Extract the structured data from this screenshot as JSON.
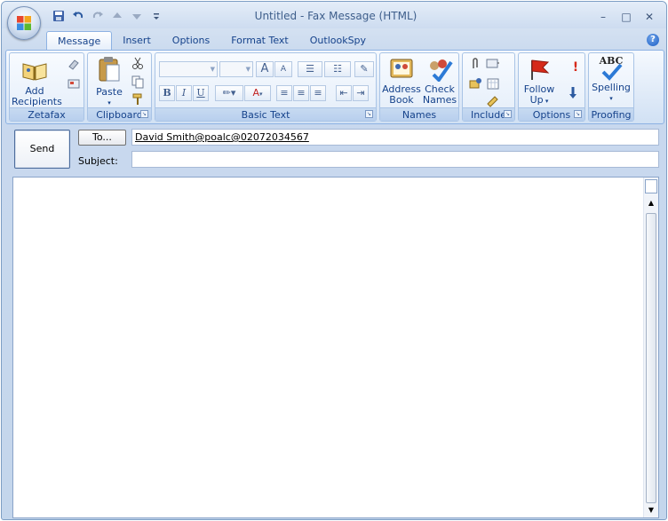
{
  "window": {
    "title": "Untitled - Fax Message (HTML)",
    "controls": {
      "minimize": "–",
      "maximize": "□",
      "close": "✕"
    }
  },
  "quick_access": [
    "save-icon",
    "undo-icon",
    "redo-icon",
    "arrow-up-icon",
    "arrow-down-icon",
    "customize-icon"
  ],
  "tabs": [
    {
      "label": "Message",
      "active": true
    },
    {
      "label": "Insert"
    },
    {
      "label": "Options"
    },
    {
      "label": "Format Text"
    },
    {
      "label": "OutlookSpy"
    }
  ],
  "help": "?",
  "ribbon": {
    "zetafax": {
      "label": "Zetafax",
      "add_recipients": [
        "Add",
        "Recipients"
      ]
    },
    "clipboard": {
      "label": "Clipboard",
      "paste": "Paste"
    },
    "basic_text": {
      "label": "Basic Text",
      "bold": "B",
      "italic": "I",
      "underline": "U",
      "grow": "A",
      "shrink": "A"
    },
    "names": {
      "label": "Names",
      "address_book": [
        "Address",
        "Book"
      ],
      "check_names": [
        "Check",
        "Names"
      ]
    },
    "include": {
      "label": "Include"
    },
    "options": {
      "label": "Options",
      "follow_up": [
        "Follow",
        "Up"
      ]
    },
    "proofing": {
      "label": "Proofing",
      "spelling": "Spelling",
      "abc": "ABC"
    }
  },
  "header": {
    "send": "Send",
    "to_button": "To...",
    "to_value": "David Smith@poalc@02072034567",
    "subject_label": "Subject:",
    "subject_value": ""
  },
  "colors": {
    "accent": "#15428b",
    "ribbon_border": "#8db2e3"
  }
}
